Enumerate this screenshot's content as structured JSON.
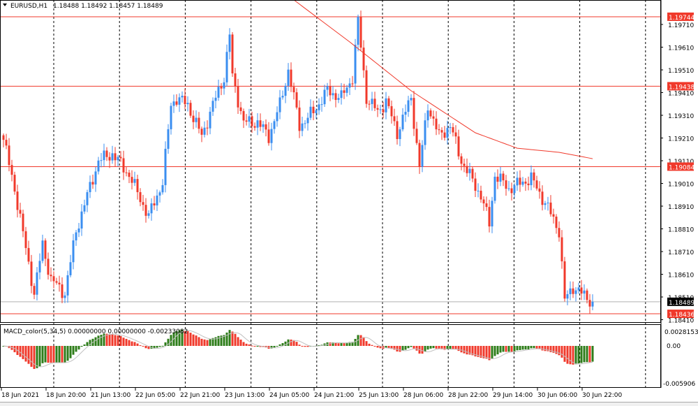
{
  "header": {
    "symbol": "EURUSD,H1",
    "ohlc": "1.18488 1.18492 1.18457 1.18489"
  },
  "macd": {
    "label": "MACD_color(5,34,5) 0.00000000 0.00000000 -0.00233082",
    "fast": 5,
    "slow": 34,
    "signal": 5,
    "scale_top": "0.0028153",
    "scale_zero": "0.00",
    "scale_bottom": "-0.005906",
    "top_value": 0.0028153,
    "bottom_value": -0.005906
  },
  "colors": {
    "bull": "#3a8ef0",
    "bear": "#f0392b",
    "macd_up": "#2e7d1a",
    "macd_down": "#f0392b",
    "hline": "#f0392b",
    "ma": "#f0392b"
  },
  "chart_data": {
    "type": "candlestick",
    "symbol": "EURUSD",
    "timeframe": "H1",
    "ylim": [
      1.1841,
      1.1971
    ],
    "y_ticks": [
      "1.19710",
      "1.19610",
      "1.19510",
      "1.19410",
      "1.19310",
      "1.19210",
      "1.19110",
      "1.19010",
      "1.18910",
      "1.18810",
      "1.18710",
      "1.18610",
      "1.18510",
      "1.18410"
    ],
    "x_ticks": [
      "18 Jun 2021",
      "18 Jun 20:00",
      "21 Jun 13:00",
      "22 Jun 05:00",
      "22 Jun 21:00",
      "23 Jun 13:00",
      "24 Jun 05:00",
      "24 Jun 21:00",
      "25 Jun 13:00",
      "28 Jun 06:00",
      "28 Jun 22:00",
      "29 Jun 14:00",
      "30 Jun 06:00",
      "30 Jun 22:00"
    ],
    "bars": 212,
    "close_path": [
      [
        0,
        1.19202
      ],
      [
        4,
        1.18987
      ],
      [
        11,
        1.18525
      ],
      [
        14,
        1.18741
      ],
      [
        17,
        1.18587
      ],
      [
        22,
        1.18525
      ],
      [
        26,
        1.18802
      ],
      [
        34,
        1.1911
      ],
      [
        39,
        1.19141
      ],
      [
        45,
        1.19048
      ],
      [
        52,
        1.18864
      ],
      [
        57,
        1.19018
      ],
      [
        60,
        1.19356
      ],
      [
        62,
        1.19387
      ],
      [
        66,
        1.19356
      ],
      [
        71,
        1.19218
      ],
      [
        75,
        1.19356
      ],
      [
        79,
        1.19479
      ],
      [
        81,
        1.19664
      ],
      [
        82,
        1.19479
      ],
      [
        86,
        1.19279
      ],
      [
        91,
        1.19279
      ],
      [
        95,
        1.19218
      ],
      [
        99,
        1.19356
      ],
      [
        102,
        1.1951
      ],
      [
        106,
        1.19264
      ],
      [
        111,
        1.19325
      ],
      [
        116,
        1.19418
      ],
      [
        121,
        1.19387
      ],
      [
        125,
        1.19479
      ],
      [
        127,
        1.19725
      ],
      [
        130,
        1.19387
      ],
      [
        134,
        1.19325
      ],
      [
        137,
        1.19372
      ],
      [
        141,
        1.19233
      ],
      [
        146,
        1.19387
      ],
      [
        149,
        1.19079
      ],
      [
        152,
        1.19356
      ],
      [
        156,
        1.19218
      ],
      [
        160,
        1.19264
      ],
      [
        164,
        1.1911
      ],
      [
        171,
        1.18956
      ],
      [
        174,
        1.18833
      ],
      [
        176,
        1.19048
      ],
      [
        181,
        1.18987
      ],
      [
        189,
        1.19033
      ],
      [
        194,
        1.18925
      ],
      [
        199,
        1.18802
      ],
      [
        201,
        1.18495
      ],
      [
        204,
        1.18556
      ],
      [
        207,
        1.18525
      ],
      [
        211,
        1.18489
      ]
    ],
    "moving_average": [
      [
        104,
        1.19818
      ],
      [
        124,
        1.19633
      ],
      [
        146,
        1.19418
      ],
      [
        169,
        1.19233
      ],
      [
        184,
        1.19165
      ],
      [
        199,
        1.19147
      ],
      [
        211,
        1.19119
      ]
    ],
    "horizontal_lines": [
      {
        "price": 1.19744,
        "label": "1.19744",
        "kind": "level"
      },
      {
        "price": 1.19438,
        "label": "1.19438",
        "kind": "level"
      },
      {
        "price": 1.19084,
        "label": "1.19084",
        "kind": "level"
      },
      {
        "price": 1.18436,
        "label": "1.18436",
        "kind": "level"
      },
      {
        "price": 1.18489,
        "label": "1.18489",
        "kind": "bid"
      }
    ]
  }
}
